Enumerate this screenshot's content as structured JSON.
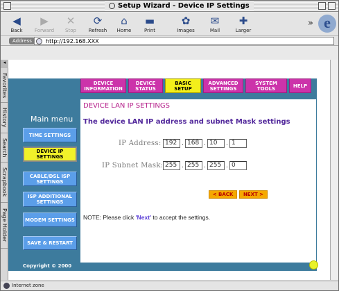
{
  "window": {
    "title": "Setup Wizard - Device IP Settings"
  },
  "toolbar": {
    "buttons": [
      {
        "label": "Back",
        "icon": "back-arrow-icon",
        "enabled": true
      },
      {
        "label": "Forward",
        "icon": "forward-arrow-icon",
        "enabled": false
      },
      {
        "label": "Stop",
        "icon": "stop-x-icon",
        "enabled": false
      },
      {
        "label": "Refresh",
        "icon": "refresh-icon",
        "enabled": true
      },
      {
        "label": "Home",
        "icon": "home-icon",
        "enabled": true
      },
      {
        "label": "Print",
        "icon": "print-icon",
        "enabled": true
      },
      {
        "label": "Images",
        "icon": "images-icon",
        "enabled": true
      },
      {
        "label": "Mail",
        "icon": "mail-icon",
        "enabled": true
      },
      {
        "label": "Larger",
        "icon": "larger-plus-icon",
        "enabled": true
      }
    ]
  },
  "address": {
    "label": "Address",
    "url": "http://192.168.XXX"
  },
  "sidebar_tabs": [
    "Favorites",
    "History",
    "Search",
    "Scrapbook",
    "Page Holder"
  ],
  "left_menu": {
    "title": "Main menu",
    "items": [
      "TIME SETTINGS",
      "DEVICE IP SETTINGS",
      "CABLE/DSL ISP SETTINGS",
      "ISP ADDITIONAL SETTINGS",
      "MODEM SETTINGS",
      "SAVE & RESTART"
    ],
    "active": "DEVICE IP SETTINGS"
  },
  "top_tabs": [
    "DEVICE INFORMATION",
    "DEVICE STATUS",
    "BASIC SETUP",
    "ADVANCED SETTINGS",
    "SYSTEM TOOLS",
    "HELP"
  ],
  "main": {
    "heading": "DEVICE LAN IP SETTINGS",
    "subheading": "The device LAN IP address and subnet Mask settings",
    "ip_label": "IP Address:",
    "ip": [
      "192",
      "168",
      "10",
      "1"
    ],
    "mask_label": "IP Subnet Mask:",
    "mask": [
      "255",
      "255",
      "255",
      "0"
    ],
    "back_label": "< BACK",
    "next_label": "NEXT >",
    "note_prefix": "NOTE: Please click ",
    "note_link": "'Next'",
    "note_suffix": " to accept the settings."
  },
  "footer": {
    "copyright": "Copyright © 2000"
  },
  "status": {
    "text": "Internet zone"
  },
  "colors": {
    "teal": "#3d7b9d",
    "magenta_tab": "#cc33aa",
    "yellow_active": "#f3ef1b",
    "blue_button": "#5b9ee9"
  }
}
